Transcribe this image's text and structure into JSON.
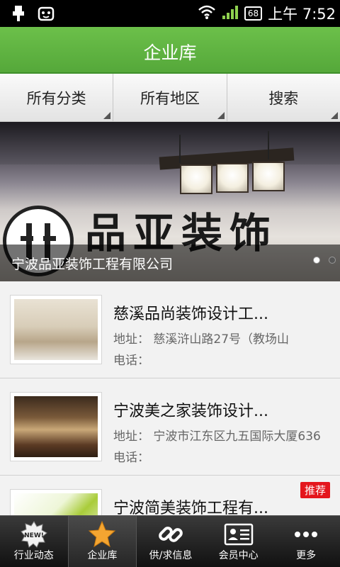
{
  "status_bar": {
    "time": "上午 7:52",
    "battery": "68",
    "icons": [
      "usb-icon",
      "android-icon",
      "wifi-icon",
      "signal-icon",
      "battery-icon"
    ]
  },
  "header": {
    "title": "企业库"
  },
  "filters": [
    {
      "label": "所有分类"
    },
    {
      "label": "所有地区"
    },
    {
      "label": "搜索"
    }
  ],
  "banner": {
    "caption": "宁波品亚装饰工程有限公司",
    "sign_text": "品亚装饰",
    "page_dots": 2,
    "active_dot": 1
  },
  "companies": [
    {
      "name": "慈溪品尚装饰设计工...",
      "address_label": "地址：",
      "address": "慈溪浒山路27号（教场山",
      "phone_label": "电话：",
      "phone": "",
      "badge": ""
    },
    {
      "name": "宁波美之家装饰设计...",
      "address_label": "地址：",
      "address": "宁波市江东区九五国际大厦636",
      "phone_label": "电话：",
      "phone": "",
      "badge": ""
    },
    {
      "name": "宁波简美装饰工程有...",
      "address_label": "",
      "address": "",
      "phone_label": "",
      "phone": "",
      "badge": "推荐"
    }
  ],
  "bottom_nav": [
    {
      "label": "行业动态",
      "icon": "new-badge-icon"
    },
    {
      "label": "企业库",
      "icon": "star-icon",
      "active": true
    },
    {
      "label": "供/求信息",
      "icon": "link-icon"
    },
    {
      "label": "会员中心",
      "icon": "member-card-icon"
    },
    {
      "label": "更多",
      "icon": "more-dots-icon"
    }
  ],
  "colors": {
    "header_green": "#5db442",
    "badge_red": "#e4161d",
    "nav_bg": "#222222"
  }
}
